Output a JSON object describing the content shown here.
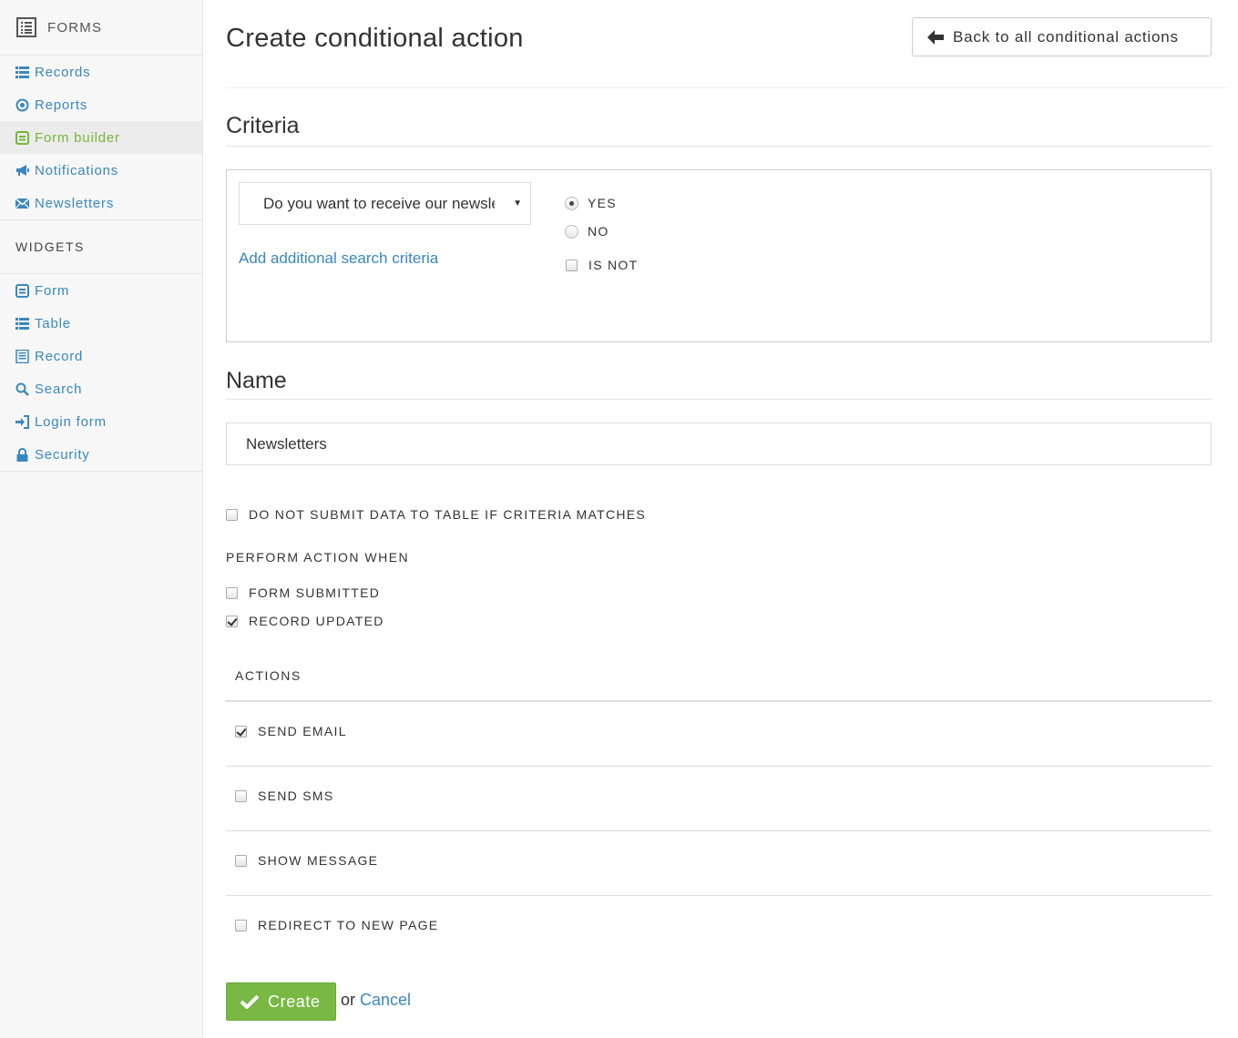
{
  "sidebar": {
    "header": {
      "label": "FORMS",
      "icon": "forms-icon"
    },
    "items": [
      {
        "label": "Records",
        "icon": "list-icon"
      },
      {
        "label": "Reports",
        "icon": "target-icon"
      },
      {
        "label": "Form builder",
        "icon": "form-icon"
      },
      {
        "label": "Notifications",
        "icon": "megaphone-icon"
      },
      {
        "label": "Newsletters",
        "icon": "envelope-icon"
      }
    ],
    "widgets_title": "WIDGETS",
    "widgets": [
      {
        "label": "Form",
        "icon": "form-icon"
      },
      {
        "label": "Table",
        "icon": "list-icon"
      },
      {
        "label": "Record",
        "icon": "document-icon"
      },
      {
        "label": "Search",
        "icon": "search-icon"
      },
      {
        "label": "Login form",
        "icon": "login-icon"
      },
      {
        "label": "Security",
        "icon": "lock-icon"
      }
    ],
    "active_color": "#74b739",
    "link_color": "#3a87c0"
  },
  "page": {
    "title": "Create conditional action",
    "back_button": "Back to all conditional actions"
  },
  "criteria": {
    "heading": "Criteria",
    "field_select": "Do you want to receive our newsletter?",
    "add_link": "Add additional search criteria",
    "options": {
      "yes": "YES",
      "no": "NO",
      "is_not": "IS NOT"
    },
    "selected": "YES"
  },
  "name_section": {
    "heading": "Name",
    "value": "Newsletters"
  },
  "options": {
    "do_not_submit": "DO NOT SUBMIT DATA TO TABLE IF CRITERIA MATCHES",
    "perform_when": "PERFORM ACTION WHEN",
    "form_submitted": "FORM SUBMITTED",
    "record_updated": "RECORD UPDATED"
  },
  "actions": {
    "heading": "ACTIONS",
    "send_email": "SEND EMAIL",
    "send_sms": "SEND SMS",
    "show_message": "SHOW MESSAGE",
    "redirect": "REDIRECT TO NEW PAGE"
  },
  "footer": {
    "create": "Create",
    "or": "or",
    "cancel": "Cancel",
    "create_color": "#78b843"
  }
}
